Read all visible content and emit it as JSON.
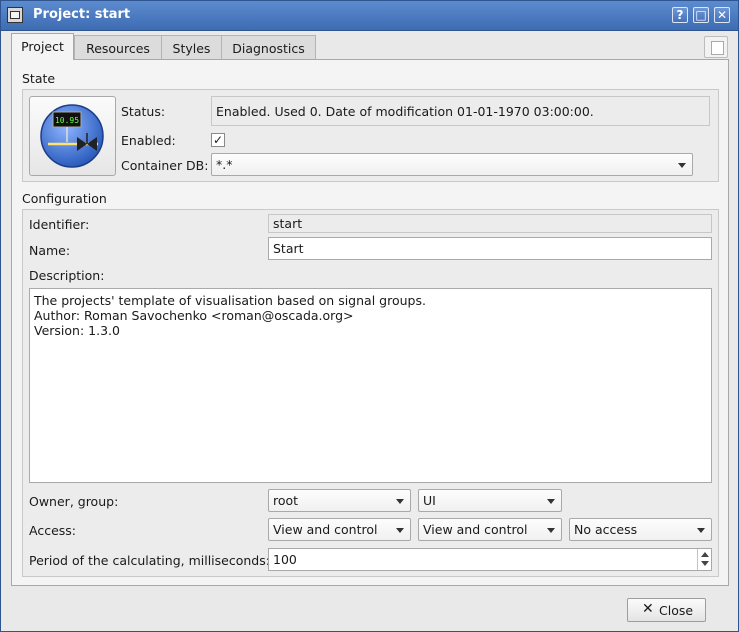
{
  "window": {
    "title": "Project: start"
  },
  "title_buttons": {
    "help": "?",
    "maximize": "□",
    "close": "✕"
  },
  "tabs": [
    {
      "label": "Project"
    },
    {
      "label": "Resources"
    },
    {
      "label": "Styles"
    },
    {
      "label": "Diagnostics"
    }
  ],
  "state": {
    "section_label": "State",
    "status_label": "Status:",
    "status_value": "Enabled. Used 0. Date of modification 01-01-1970 03:00:00.",
    "enabled_label": "Enabled:",
    "enabled_mark": "✓",
    "container_db_label": "Container DB:",
    "container_db_value": "*.*",
    "icon_readout": "10.95"
  },
  "configuration": {
    "section_label": "Configuration",
    "identifier_label": "Identifier:",
    "identifier_value": "start",
    "name_label": "Name:",
    "name_value": "Start",
    "description_label": "Description:",
    "description_lines": [
      "The projects' template of visualisation based on signal groups.",
      "Author: Roman Savochenko <roman@oscada.org>",
      "Version: 1.3.0"
    ],
    "owner_group_label": "Owner, group:",
    "owner_value": "root",
    "group_value": "UI",
    "access_label": "Access:",
    "access_owner": "View and control",
    "access_group": "View and control",
    "access_others": "No access",
    "period_label": "Period of the calculating, milliseconds:",
    "period_value": "100"
  },
  "footer": {
    "close_label": "Close"
  },
  "colors": {
    "titlebar": "#4a78c0",
    "window_bg": "#e9e9e9",
    "icon_circle": "#3c6fd0"
  }
}
